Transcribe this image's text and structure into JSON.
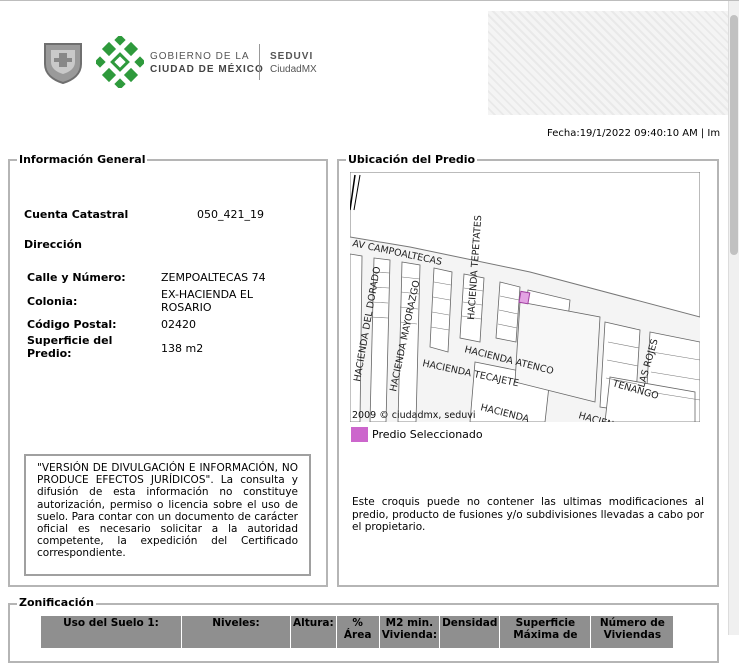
{
  "header": {
    "gov_line1": "GOBIERNO DE LA",
    "gov_line2": "CIUDAD DE MÉXICO",
    "agency": "SEDUVI",
    "agency_sub": "CiudadMX",
    "fecha": "Fecha:19/1/2022 09:40:10 AM | Im"
  },
  "general": {
    "legend": "Información General",
    "cuenta_label": "Cuenta Catastral",
    "cuenta_value": "050_421_19",
    "direccion_label": "Dirección",
    "calle_label": "Calle y Número:",
    "calle_value": "ZEMPOALTECAS 74",
    "colonia_label": "Colonia:",
    "colonia_value_1": "EX-HACIENDA EL",
    "colonia_value_2": "ROSARIO",
    "cp_label": "Código Postal:",
    "cp_value": "02420",
    "superficie_label_1": "Superficie del",
    "superficie_label_2": "Predio:",
    "superficie_value": "138 m2",
    "disclaimer": "\"VERSIÓN DE DIVULGACIÓN E INFORMACIÓN, NO PRODUCE EFECTOS JURÍDICOS\". La consulta y difusión de esta información no constituye autorización, permiso o licencia sobre el uso de suelo. Para contar con un documento de carácter oficial es necesario solicitar a la autoridad competente, la expedición del Certificado correspondiente."
  },
  "ubicacion": {
    "legend": "Ubicación del Predio",
    "streets": {
      "av": "AV CAMPOALTECAS",
      "tepetates": "HACIENDA TEPETATES",
      "dorado": "HACIENDA DEL DORADO",
      "mayorazgo": "HACIENDA MAYORAZGO",
      "atenco": "HACIENDA ATENCO",
      "tecajete": "HACIENDA TECAJETE",
      "tenango": "TENANGO",
      "rojes": "LAS ROJES",
      "hacienda_bottom1": "HACIENDA",
      "hacienda_bottom2": "HACIEN"
    },
    "copyright": "2009 © ciudadmx, seduvi",
    "legend_item": "Predio Seleccionado",
    "legend_color": "#cc66cc",
    "croquis_note": "Este croquis puede no contener las ultimas modificaciones al predio, producto de fusiones y/o subdivisiones llevadas a cabo por el propietario."
  },
  "zonificacion": {
    "legend": "Zonificación",
    "columns": [
      {
        "line1": "Uso del Suelo 1:",
        "line2": ""
      },
      {
        "line1": "Niveles:",
        "line2": ""
      },
      {
        "line1": "Altura:",
        "line2": ""
      },
      {
        "line1": "%",
        "line2": "Área"
      },
      {
        "line1": "M2 min.",
        "line2": "Vivienda:"
      },
      {
        "line1": "Densidad",
        "line2": ""
      },
      {
        "line1": "Superficie",
        "line2": "Máxima de"
      },
      {
        "line1": "Número de",
        "line2": "Viviendas"
      }
    ],
    "header_color": "#8f8f8f"
  }
}
